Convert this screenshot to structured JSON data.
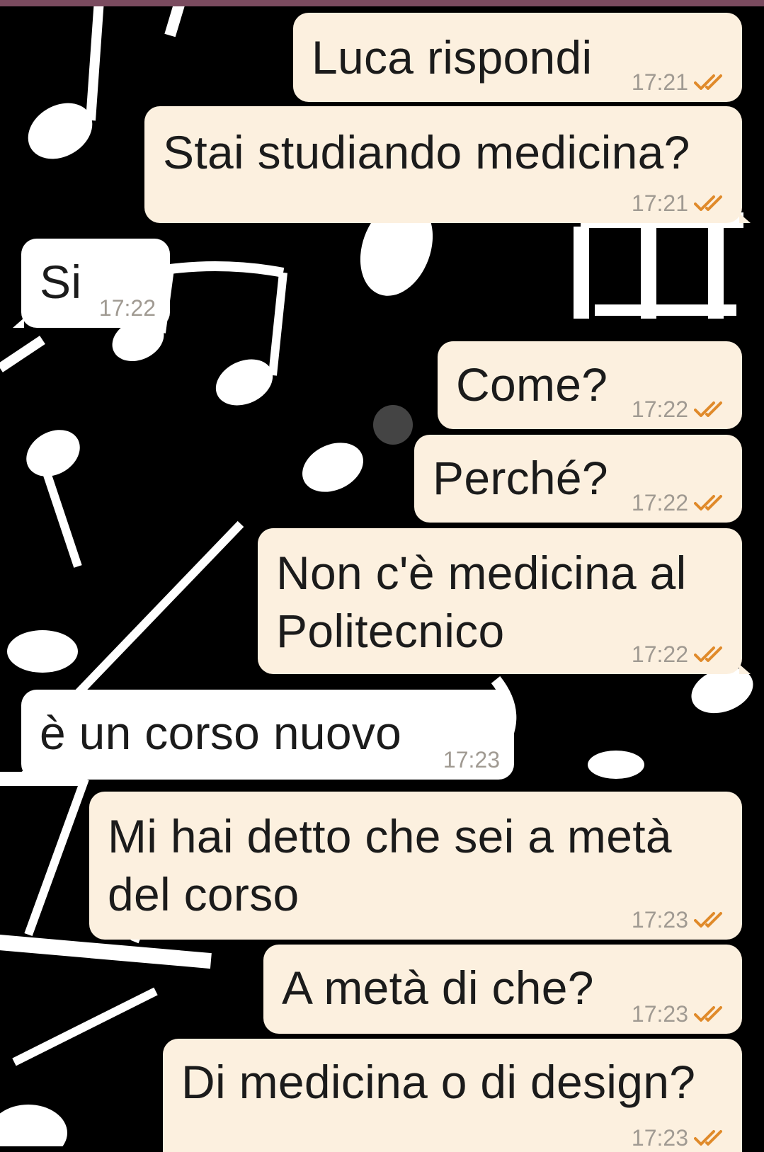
{
  "chat": {
    "messages": [
      {
        "dir": "out",
        "text": "Luca rispondi",
        "time": "17:21",
        "status": "read"
      },
      {
        "dir": "out",
        "text": "Stai studiando medicina?",
        "time": "17:21",
        "status": "read"
      },
      {
        "dir": "in",
        "text": "Si",
        "time": "17:22"
      },
      {
        "dir": "out",
        "text": "Come?",
        "time": "17:22",
        "status": "read"
      },
      {
        "dir": "out",
        "text": "Perché?",
        "time": "17:22",
        "status": "read"
      },
      {
        "dir": "out",
        "text_line1": "Non c'è medicina al",
        "text_line2": "Politecnico",
        "time": "17:22",
        "status": "read"
      },
      {
        "dir": "in",
        "text": "è un corso nuovo",
        "time": "17:23"
      },
      {
        "dir": "out",
        "text_line1": "Mi hai detto che sei a metà",
        "text_line2": "del corso",
        "time": "17:23",
        "status": "read"
      },
      {
        "dir": "out",
        "text": "A metà di che?",
        "time": "17:23",
        "status": "read"
      },
      {
        "dir": "out",
        "text": "Di medicina o di design?",
        "time": "17:23",
        "status": "read"
      }
    ]
  },
  "colors": {
    "outgoing_bubble": "#fcf0df",
    "incoming_bubble": "#ffffff",
    "wallpaper": "#000000",
    "notes": "#ffffff",
    "read_ticks": "#e08a2a",
    "top_bar": "#7a4b5f"
  },
  "icons": {
    "read_receipt": "double-check-icon",
    "wallpaper": "music-notes-wallpaper"
  }
}
